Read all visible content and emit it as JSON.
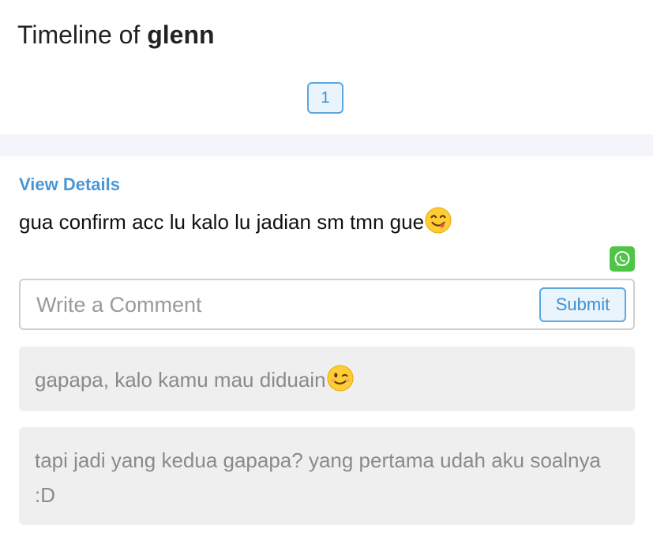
{
  "header": {
    "title_prefix": "Timeline of",
    "username": "glenn"
  },
  "pagination": {
    "current_page": "1"
  },
  "post": {
    "view_details_label": "View Details",
    "text": "gua confirm acc lu kalo lu jadian sm tmn gue",
    "text_emoji": "yum-face-icon",
    "share_icon": "whatsapp-icon"
  },
  "comment_form": {
    "placeholder": "Write a Comment",
    "value": "",
    "submit_label": "Submit"
  },
  "comments": [
    {
      "text": "gapapa, kalo kamu mau diduain",
      "emoji": "winking-face-icon"
    },
    {
      "text": "tapi jadi yang kedua gapapa? yang pertama udah aku soalnya :D"
    }
  ],
  "colors": {
    "accent": "#4a97d6",
    "whatsapp": "#4fc546",
    "comment_bg": "#efefef",
    "band_bg": "#f4f5fb"
  }
}
